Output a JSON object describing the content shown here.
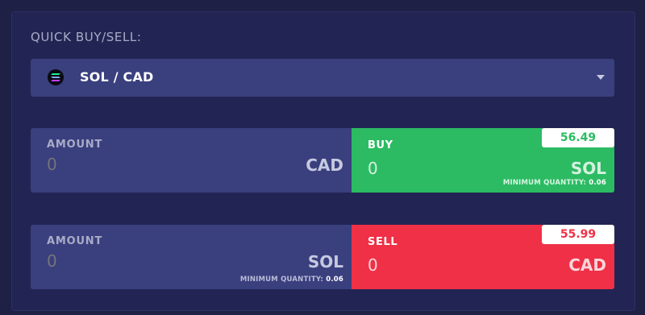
{
  "title": "QUICK BUY/SELL:",
  "pair_select": {
    "icon": "solana-logo-icon",
    "label": "SOL / CAD"
  },
  "buy_row": {
    "amount_label": "AMOUNT",
    "amount_placeholder": "0",
    "amount_unit": "CAD",
    "action_label": "BUY",
    "action_value": "0",
    "action_unit": "SOL",
    "price": "56.49",
    "min_qty_label": "MINIMUM QUANTITY:",
    "min_qty_value": "0.06",
    "color": "#2cbb63"
  },
  "sell_row": {
    "amount_label": "AMOUNT",
    "amount_placeholder": "0",
    "amount_unit": "SOL",
    "min_qty_label": "MINIMUM QUANTITY:",
    "min_qty_value": "0.06",
    "action_label": "SELL",
    "action_value": "0",
    "action_unit": "CAD",
    "price": "55.99",
    "color": "#ef3046"
  }
}
